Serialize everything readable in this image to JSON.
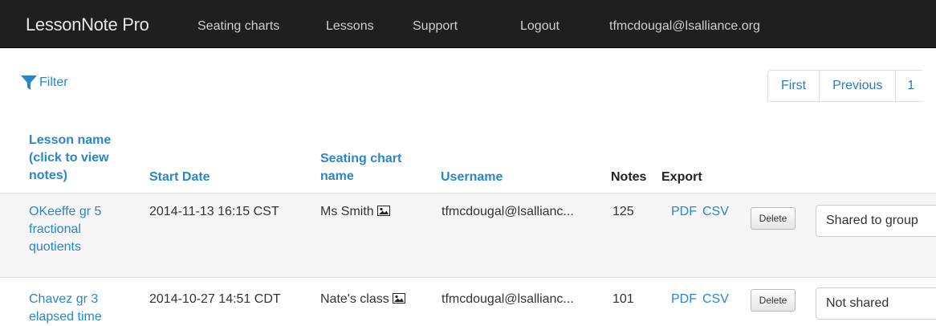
{
  "navbar": {
    "brand": "LessonNote Pro",
    "items": [
      "Seating charts",
      "Lessons",
      "Support",
      "Logout",
      "tfmcdougal@lsalliance.org"
    ]
  },
  "toolbar": {
    "filter_label": "Filter",
    "filter_icon": "funnel-icon"
  },
  "pagination": {
    "first": "First",
    "previous": "Previous",
    "current_page": "1"
  },
  "table": {
    "headers": {
      "lesson_name": [
        "Lesson name",
        "(click to view",
        "notes)"
      ],
      "start_date": "Start Date",
      "seating_chart": [
        "Seating chart",
        "name"
      ],
      "username": "Username",
      "notes": "Notes",
      "export": "Export"
    },
    "rows": [
      {
        "lesson_name": [
          "OKeeffe gr 5",
          "fractional",
          "quotients"
        ],
        "start_date": "2014-11-13 16:15 CST",
        "seating_chart": "Ms Smith",
        "username": "tfmcdougal@lsallianc...",
        "notes": "125",
        "pdf": "PDF",
        "csv": "CSV",
        "delete": "Delete",
        "sharing": "Shared to group"
      },
      {
        "lesson_name": [
          "Chavez gr 3",
          "elapsed time"
        ],
        "start_date": "2014-10-27 14:51 CDT",
        "seating_chart": "Nate's class",
        "username": "tfmcdougal@lsallianc...",
        "notes": "101",
        "pdf": "PDF",
        "csv": "CSV",
        "delete": "Delete",
        "sharing": "Not shared"
      }
    ]
  },
  "colors": {
    "navbar_bg": "#1f1f1f",
    "link": "#2a86c9",
    "row_stripe": "#f5f5f5"
  }
}
